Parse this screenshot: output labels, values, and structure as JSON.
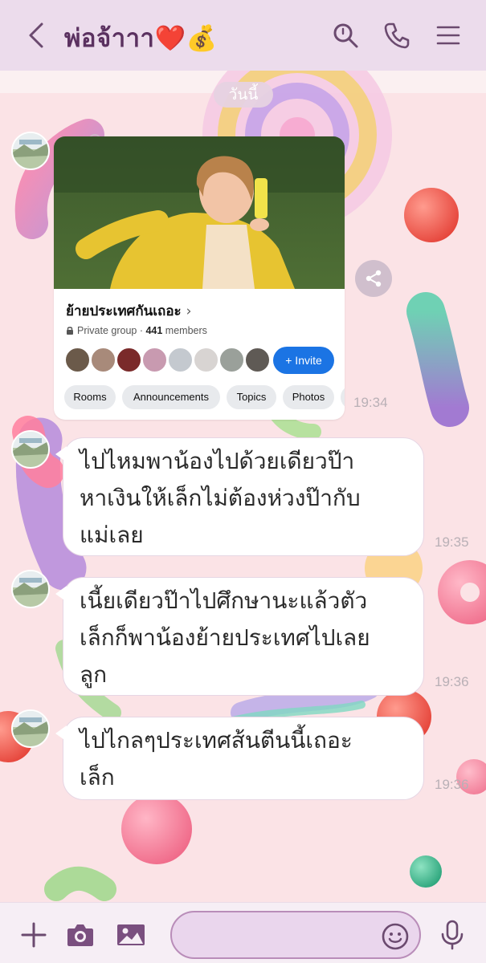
{
  "header": {
    "title": "พ่อจ้าาา❤️💰",
    "icons": [
      "back-chevron-icon",
      "search-icon",
      "phone-icon",
      "menu-icon"
    ]
  },
  "chat": {
    "date_label": "วันนี้",
    "shared_card": {
      "group_name": "ย้ายประเทศกันเถอะ",
      "chevron": "›",
      "privacy": "Private group",
      "separator": " · ",
      "member_count": "441",
      "members_word": " members",
      "invite_label": "+ Invite",
      "chips": [
        "Rooms",
        "Announcements",
        "Topics",
        "Photos"
      ],
      "time": "19:34"
    },
    "messages": [
      {
        "text": "ไปไหมพาน้องไปด้วยเดียวป๊า\nหาเงินให้เล็กไม่ต้องห่วงป๊ากับ\nแม่เลย",
        "time": "19:35"
      },
      {
        "text": "เนี้ยเดียวป๊าไปศึกษานะแล้วตัว\nเล็กก็พาน้องย้ายประเทศไปเลย\nลูก",
        "time": "19:36"
      },
      {
        "text": "ไปไกลๆประเทศส้นตีนนี้เถอะ\nเล็ก",
        "time": "19:36"
      }
    ]
  },
  "composer": {
    "placeholder": "",
    "icons": [
      "plus-icon",
      "camera-icon",
      "gallery-icon",
      "emoji-icon",
      "microphone-icon"
    ]
  },
  "colors": {
    "header_bg": "#ecdcec",
    "title_color": "#5b3160",
    "chat_bg": "#fbe3e6",
    "invite_blue": "#1b74e4",
    "icon_color": "#6b4a6f"
  }
}
